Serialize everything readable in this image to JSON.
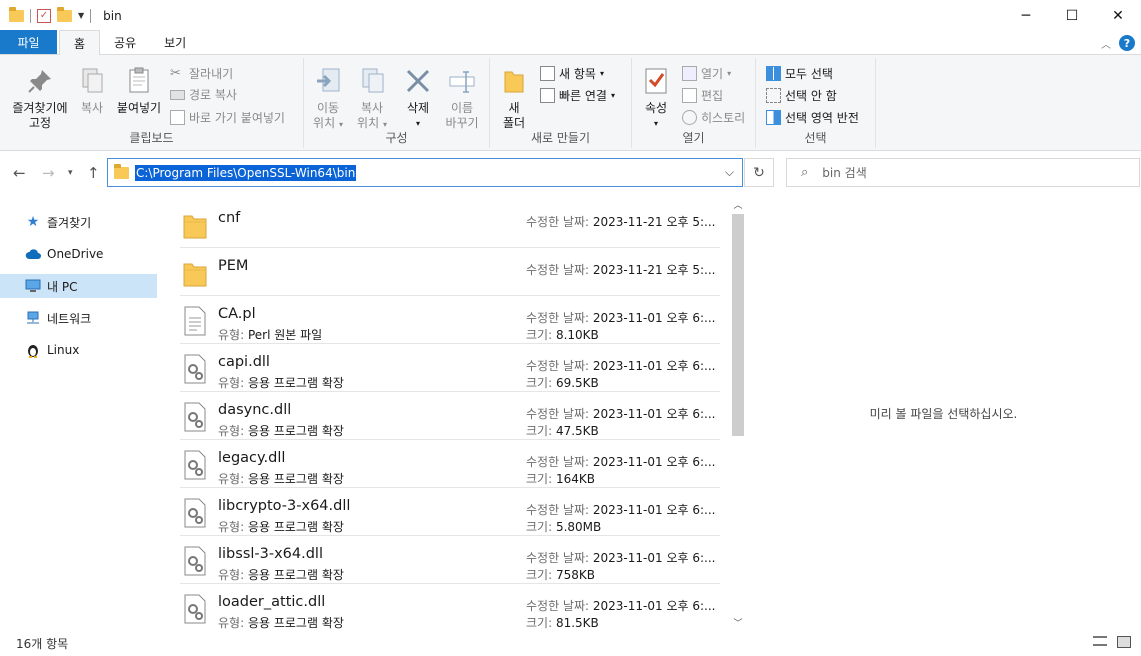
{
  "window": {
    "title": "bin",
    "minimize_label": "─",
    "maximize_label": "☐",
    "close_label": "✕"
  },
  "tabs": [
    "파일",
    "홈",
    "공유",
    "보기"
  ],
  "ribbon": {
    "clipboard": {
      "label": "클립보드",
      "pin_line1": "즐겨찾기에",
      "pin_line2": "고정",
      "copy": "복사",
      "paste": "붙여넣기",
      "cut": "잘라내기",
      "copy_path": "경로 복사",
      "paste_shortcut": "바로 가기 붙여넣기"
    },
    "organize": {
      "label": "구성",
      "move_line1": "이동",
      "move_line2": "위치",
      "copyto_line1": "복사",
      "copyto_line2": "위치",
      "delete": "삭제",
      "rename_line1": "이름",
      "rename_line2": "바꾸기"
    },
    "new": {
      "label": "새로 만들기",
      "new_folder_line1": "새",
      "new_folder_line2": "폴더",
      "new_item": "새 항목",
      "easy_access": "빠른 연결"
    },
    "open": {
      "label": "열기",
      "properties": "속성",
      "open": "열기",
      "edit": "편집",
      "history": "히스토리"
    },
    "select": {
      "label": "선택",
      "select_all": "모두 선택",
      "select_none": "선택 안 함",
      "invert": "선택 영역 반전"
    }
  },
  "address": {
    "path": "C:\\Program Files\\OpenSSL-Win64\\bin",
    "search_placeholder": "bin 검색"
  },
  "nav": [
    {
      "label": "즐겨찾기",
      "icon": "star-icon"
    },
    {
      "label": "OneDrive",
      "icon": "cloud-icon"
    },
    {
      "label": "내 PC",
      "icon": "pc-icon",
      "selected": true
    },
    {
      "label": "네트워크",
      "icon": "network-icon"
    },
    {
      "label": "Linux",
      "icon": "linux-icon"
    }
  ],
  "labels": {
    "modified": "수정한 날짜:",
    "type": "유형:",
    "size": "크기:"
  },
  "files": [
    {
      "name": "cnf",
      "kind": "folder",
      "modified": "2023-11-21 오후 5:..."
    },
    {
      "name": "PEM",
      "kind": "folder",
      "modified": "2023-11-21 오후 5:..."
    },
    {
      "name": "CA.pl",
      "kind": "text",
      "type": "Perl 원본 파일",
      "modified": "2023-11-01 오후 6:...",
      "size": "8.10KB"
    },
    {
      "name": "capi.dll",
      "kind": "dll",
      "type": "응용 프로그램 확장",
      "modified": "2023-11-01 오후 6:...",
      "size": "69.5KB"
    },
    {
      "name": "dasync.dll",
      "kind": "dll",
      "type": "응용 프로그램 확장",
      "modified": "2023-11-01 오후 6:...",
      "size": "47.5KB"
    },
    {
      "name": "legacy.dll",
      "kind": "dll",
      "type": "응용 프로그램 확장",
      "modified": "2023-11-01 오후 6:...",
      "size": "164KB"
    },
    {
      "name": "libcrypto-3-x64.dll",
      "kind": "dll",
      "type": "응용 프로그램 확장",
      "modified": "2023-11-01 오후 6:...",
      "size": "5.80MB"
    },
    {
      "name": "libssl-3-x64.dll",
      "kind": "dll",
      "type": "응용 프로그램 확장",
      "modified": "2023-11-01 오후 6:...",
      "size": "758KB"
    },
    {
      "name": "loader_attic.dll",
      "kind": "dll",
      "type": "응용 프로그램 확장",
      "modified": "2023-11-01 오후 6:...",
      "size": "81.5KB"
    }
  ],
  "preview_text": "미리 볼 파일을 선택하십시오.",
  "status": {
    "item_count": "16개 항목"
  },
  "colors": {
    "accent": "#1979ca",
    "selection": "#cce4f7",
    "address_highlight": "#0a64d8"
  }
}
